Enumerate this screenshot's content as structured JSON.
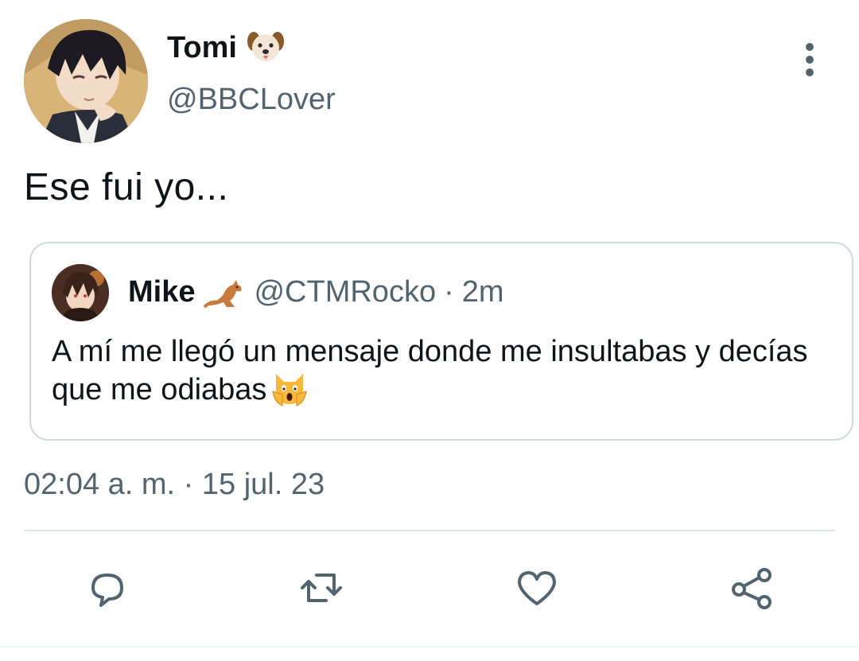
{
  "tweet": {
    "author_name": "Tomi",
    "author_handle": "@BBCLover",
    "text": "Ese fui yo...",
    "timestamp": "02:04 a. m. · 15 jul. 23"
  },
  "quoted": {
    "author_name": "Mike",
    "author_handle": "@CTMRocko",
    "separator": "·",
    "time_ago": "2m",
    "text": "A mí me llegó un mensaje donde me insultabas y decías que me odiabas"
  },
  "icons": {
    "name_emoji": "dog-face-emoji",
    "quote_name_emoji": "kangaroo-emoji",
    "text_emoji": "weary-cat-emoji",
    "more": "more-vertical-icon",
    "reply": "reply-icon",
    "retweet": "retweet-icon",
    "like": "heart-icon",
    "share": "share-icon"
  },
  "colors": {
    "primary_text": "#0f1419",
    "secondary_text": "#536471",
    "border": "#cfd9de",
    "icon": "#536471"
  }
}
